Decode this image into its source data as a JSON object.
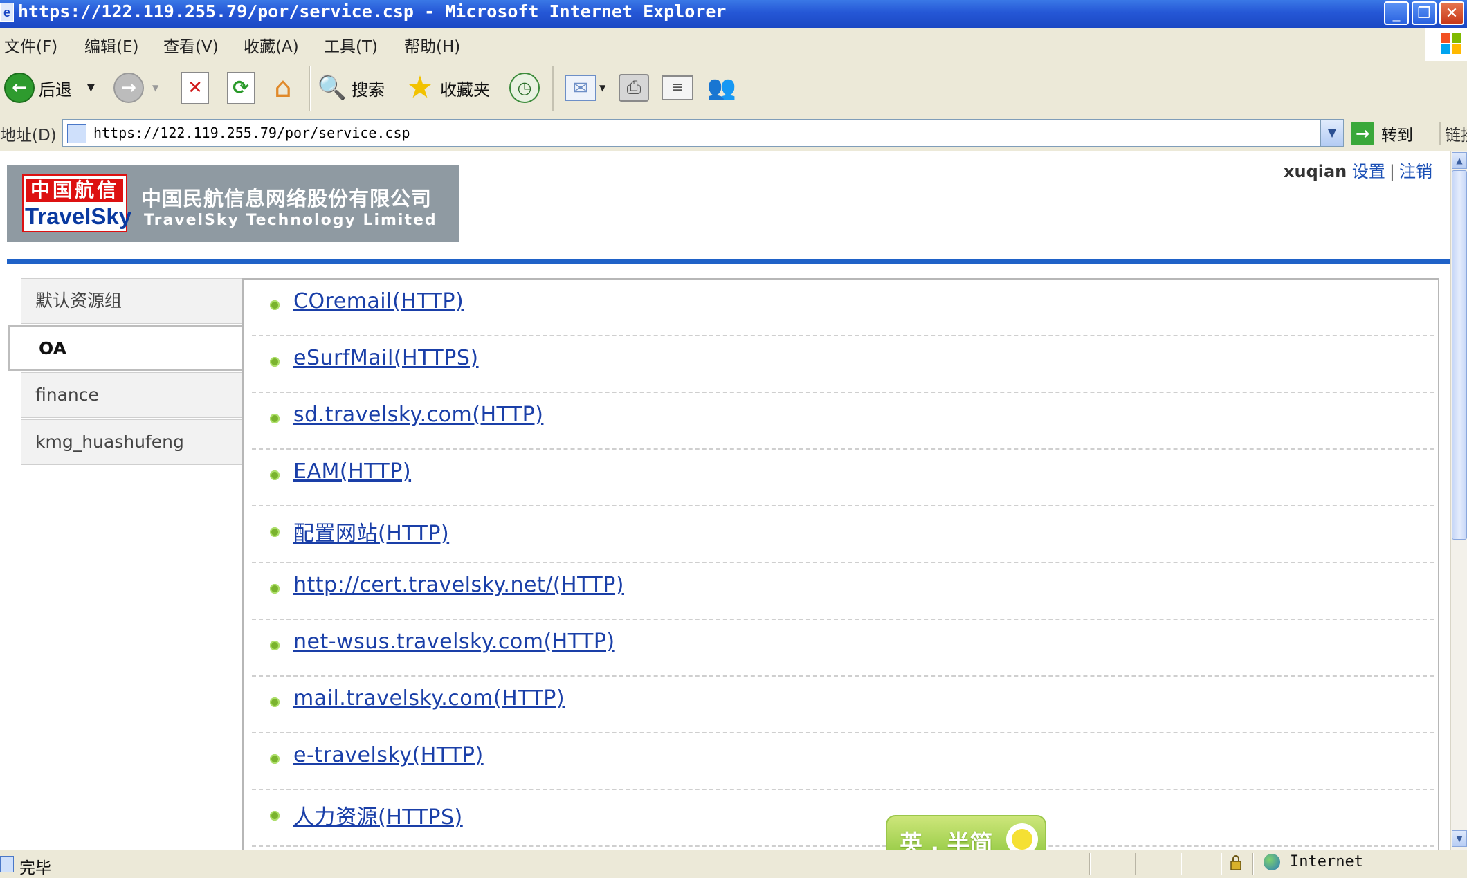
{
  "window": {
    "title": "https://122.119.255.79/por/service.csp - Microsoft Internet Explorer",
    "controls": {
      "minimize": "_",
      "maximize": "❐",
      "close": "✕"
    }
  },
  "menu": [
    "文件(F)",
    "编辑(E)",
    "查看(V)",
    "收藏(A)",
    "工具(T)",
    "帮助(H)"
  ],
  "toolbar": {
    "back_label": "后退",
    "search_label": "搜索",
    "favorites_label": "收藏夹"
  },
  "address": {
    "label": "地址(D)",
    "url": "https://122.119.255.79/por/service.csp",
    "go_label": "转到",
    "links_label": "链接"
  },
  "header": {
    "logo_cn_top": "中国航信",
    "logo_en_bottom": "TravelSky",
    "company_cn": "中国民航信息网络股份有限公司",
    "company_en": "TravelSky Technology Limited",
    "username": "xuqian",
    "settings_link": "设置",
    "logout_link": "注销",
    "accent_color": "#1f62c8"
  },
  "groups": [
    {
      "label": "默认资源组",
      "active": false
    },
    {
      "label": "OA",
      "active": true
    },
    {
      "label": "finance",
      "active": false
    },
    {
      "label": "kmg_huashufeng",
      "active": false
    }
  ],
  "services": [
    "COremail(HTTP)",
    "eSurfMail(HTTPS)",
    "sd.travelsky.com(HTTP)",
    "EAM(HTTP)",
    "配置网站(HTTP)",
    "http://cert.travelsky.net/(HTTP)",
    "net-wsus.travelsky.com(HTTP)",
    "mail.travelsky.com(HTTP)",
    "e-travelsky(HTTP)",
    "人力资源(HTTPS)"
  ],
  "ime": {
    "label": "英 , 半简"
  },
  "status": {
    "text": "完毕",
    "zone": "Internet"
  }
}
